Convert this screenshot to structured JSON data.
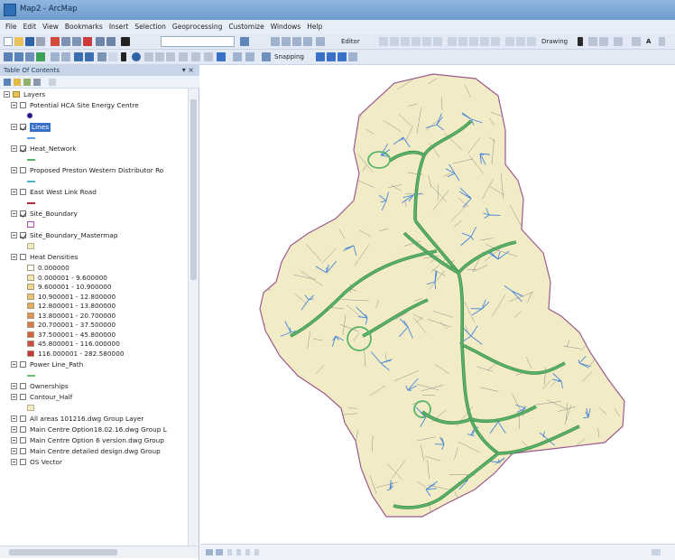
{
  "window": {
    "title": "Map2 - ArcMap"
  },
  "menus": [
    "File",
    "Edit",
    "View",
    "Bookmarks",
    "Insert",
    "Selection",
    "Geoprocessing",
    "Customize",
    "Windows",
    "Help"
  ],
  "toolbar": {
    "editor_label": "Editor",
    "drawing_label": "Drawing",
    "snapping_label": "Snapping",
    "scale_value": ""
  },
  "toc": {
    "title": "Table Of Contents",
    "root_label": "Layers",
    "layers": [
      {
        "name": "Potential HCA Site Energy Centre",
        "checked": false,
        "symbol": "point",
        "color": "#2b1b8a"
      },
      {
        "name": "Lines",
        "checked": true,
        "selected": true,
        "symbol": "line",
        "color": "#5aa0e0"
      },
      {
        "name": "Heat_Network",
        "checked": true,
        "symbol": "line",
        "color": "#58b368"
      },
      {
        "name": "Proposed Preston Western Distributor Ro",
        "checked": false,
        "symbol": "line",
        "color": "#4db2c8"
      },
      {
        "name": "East West Link Road",
        "checked": false,
        "symbol": "line",
        "color": "#b0283a"
      },
      {
        "name": "Site_Boundary",
        "checked": true,
        "symbol": "polygon-outline",
        "color": "#b54bb8"
      },
      {
        "name": "Site_Boundary_Mastermap",
        "checked": true,
        "symbol": "polygon",
        "color": "#f2ecc6"
      },
      {
        "name": "Heat Densities",
        "checked": false,
        "symbol": "none",
        "color": ""
      }
    ],
    "heat_classes": [
      {
        "label": "0.000000",
        "color": "#ffffff"
      },
      {
        "label": "0.000001 - 9.600000",
        "color": "#f3e7b3"
      },
      {
        "label": "9.600001 - 10.900000",
        "color": "#efd78f"
      },
      {
        "label": "10.900001 - 12.800000",
        "color": "#e9c474"
      },
      {
        "label": "12.800001 - 13.800000",
        "color": "#e3ad63"
      },
      {
        "label": "13.800001 - 20.700000",
        "color": "#dc9459"
      },
      {
        "label": "20.700001 - 37.500000",
        "color": "#d77a4e"
      },
      {
        "label": "37.500001 - 45.800000",
        "color": "#d35f47"
      },
      {
        "label": "45.800001 - 116.000000",
        "color": "#cf4a40"
      },
      {
        "label": "116.000001 - 282.580000",
        "color": "#c73439"
      }
    ],
    "other_layers": [
      {
        "name": "Power Line_Path",
        "checked": false,
        "symbol": "line",
        "color": "#6bbf6e"
      },
      {
        "name": "Ownerships",
        "checked": false,
        "symbol": "none",
        "color": ""
      },
      {
        "name": "Contour_Half",
        "checked": false,
        "symbol": "polygon",
        "color": "#f2ecc6"
      },
      {
        "name": "All areas 101216.dwg Group Layer",
        "checked": false,
        "symbol": "none",
        "color": ""
      },
      {
        "name": "Main Centre Option18.02.16.dwg Group L",
        "checked": false,
        "symbol": "none",
        "color": ""
      },
      {
        "name": "Main Centre Option 6 version.dwg Group",
        "checked": false,
        "symbol": "none",
        "color": ""
      },
      {
        "name": "Main Centre detailed design.dwg Group",
        "checked": false,
        "symbol": "none",
        "color": ""
      },
      {
        "name": "OS Vector",
        "checked": false,
        "symbol": "none",
        "color": ""
      }
    ]
  },
  "map": {
    "fill_color": "#f2ecc6",
    "parcel_line_color": "#8c8c8c",
    "boundary_color": "#9a5b8f",
    "heat_network_color": "#58b368",
    "service_line_color": "#4a86d8"
  }
}
